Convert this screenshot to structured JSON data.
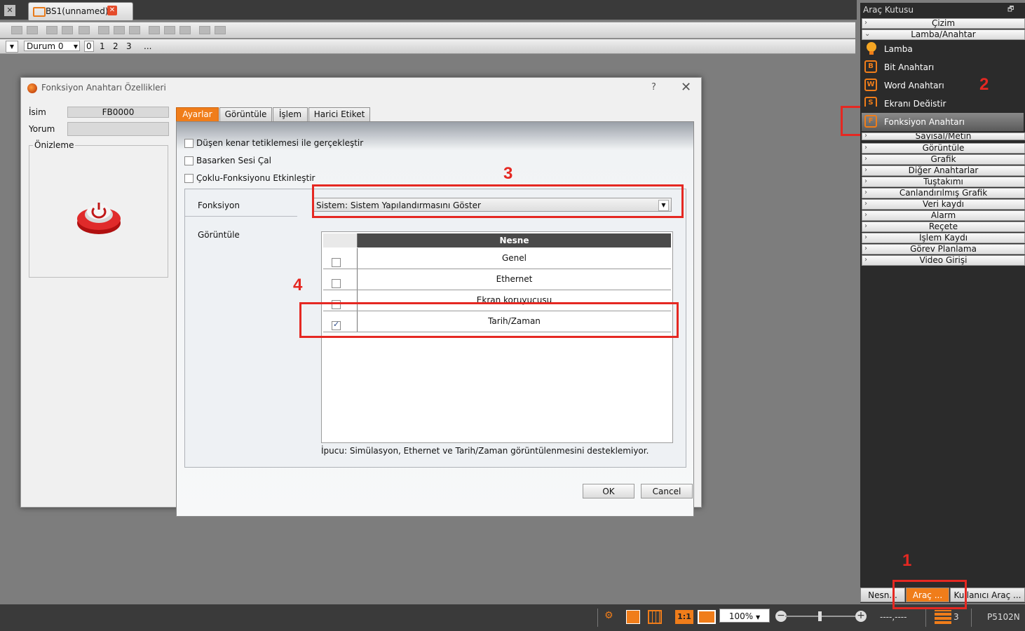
{
  "tabbar": {
    "doc_tab_label": "BS1(unnamed)"
  },
  "toolbar2": {
    "state_combo": "Durum 0",
    "state_numbers": [
      "0",
      "1",
      "2",
      "3",
      "..."
    ]
  },
  "dialog": {
    "title": "Fonksiyon Anahtarı Özellikleri",
    "help": "?",
    "close": "✕",
    "name_label": "İsim",
    "name_value": "FB0000",
    "comment_label": "Yorum",
    "comment_value": "",
    "preview_label": "Önizleme",
    "tabs": [
      "Ayarlar",
      "Görüntüle",
      "İşlem",
      "Harici Etiket"
    ],
    "checkboxes": [
      {
        "label": "Düşen kenar tetiklemesi ile gerçekleştir",
        "checked": false
      },
      {
        "label": "Basarken Sesi Çal",
        "checked": false
      },
      {
        "label": "Çoklu-Fonksiyonu Etkinleştir",
        "checked": false
      }
    ],
    "function_label": "Fonksiyon",
    "function_value": "Sistem: Sistem Yapılandırmasını Göster",
    "display_label": "Görüntüle",
    "list_header": "Nesne",
    "list_rows": [
      {
        "label": "Genel",
        "checked": false
      },
      {
        "label": "Ethernet",
        "checked": false
      },
      {
        "label": "Ekran koruyucusu",
        "checked": false
      },
      {
        "label": "Tarih/Zaman",
        "checked": true
      }
    ],
    "hint": "İpucu: Simülasyon, Ethernet ve Tarih/Zaman görüntülenmesini desteklemiyor.",
    "ok": "OK",
    "cancel": "Cancel"
  },
  "annotations": [
    "1",
    "2",
    "3",
    "4"
  ],
  "toolbox": {
    "title": "Araç Kutusu",
    "pin": "🗗",
    "categories_top": [
      "Çizim",
      "Lamba/Anahtar"
    ],
    "items": [
      {
        "label": "Lamba",
        "icon": "lamp-icon",
        "glyph": "",
        "selected": false
      },
      {
        "label": "Bit Anahtarı",
        "icon": "bit-switch-icon",
        "glyph": "B",
        "selected": false
      },
      {
        "label": "Word Anahtarı",
        "icon": "word-switch-icon",
        "glyph": "W",
        "selected": false
      },
      {
        "label": "Ekranı Değiştir",
        "icon": "screen-change-icon",
        "glyph": "S",
        "selected": false
      },
      {
        "label": "Fonksiyon Anahtarı",
        "icon": "function-switch-icon",
        "glyph": "F",
        "selected": true
      }
    ],
    "categories_bottom": [
      "Sayısal/Metin",
      "Görüntüle",
      "Grafik",
      "Diğer Anahtarlar",
      "Tuştakımı",
      "Canlandırılmış Grafik",
      "Veri kaydı",
      "Alarm",
      "Reçete",
      "İşlem Kaydı",
      "Görev Planlama",
      "Video Girişi"
    ],
    "bottom_tabs": [
      "Nesn...",
      "Araç ...",
      "Kullanıcı Araç ..."
    ]
  },
  "statusbar": {
    "zoom": "100%",
    "coords": "----,----",
    "layer_count": "3",
    "model": "P5102N"
  },
  "colors": {
    "accent": "#f07d1a",
    "annotation_red": "#e52822"
  }
}
